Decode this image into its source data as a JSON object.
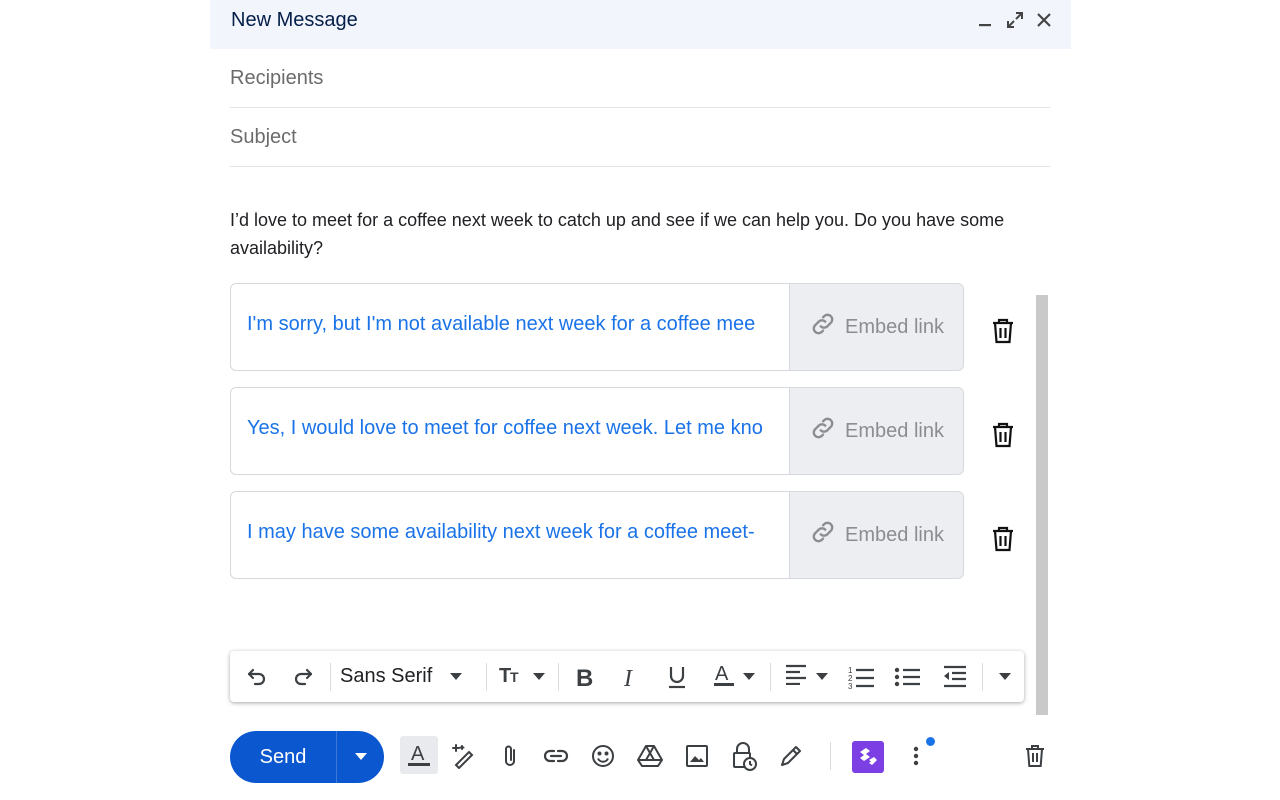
{
  "window": {
    "title": "New Message"
  },
  "fields": {
    "recipients_placeholder": "Recipients",
    "subject_placeholder": "Subject"
  },
  "body": {
    "text": "I’d love to meet for a coffee next week to catch up and see if we can help you. Do you have some availability?"
  },
  "suggestions": [
    {
      "text": "I'm sorry, but I'm not available next week for a coffee mee",
      "embed_label": "Embed link"
    },
    {
      "text": "Yes, I would love to meet for coffee next week. Let me kno",
      "embed_label": "Embed link"
    },
    {
      "text": "I may have some availability next week for a coffee meet-",
      "embed_label": "Embed link"
    }
  ],
  "format_toolbar": {
    "font_family": "Sans Serif",
    "icons": [
      "undo-icon",
      "redo-icon",
      "text-size-icon",
      "bold-icon",
      "italic-icon",
      "underline-icon",
      "text-color-icon",
      "align-icon",
      "numbered-list-icon",
      "bulleted-list-icon",
      "indent-less-icon",
      "more-formatting-icon"
    ]
  },
  "bottom_toolbar": {
    "send_label": "Send",
    "icons": [
      "formatting-options-icon",
      "help-me-write-icon",
      "attach-icon",
      "link-icon",
      "emoji-icon",
      "drive-icon",
      "photo-icon",
      "confidential-icon",
      "signature-icon",
      "extension-icon",
      "more-options-icon",
      "discard-icon"
    ],
    "notification_dot_color": "#1a73e8"
  },
  "colors": {
    "header_bg": "#f2f6fc",
    "accent": "#0b57d0",
    "suggestion_text": "#1a73e8",
    "extension_brand": "#7b3fe4"
  }
}
